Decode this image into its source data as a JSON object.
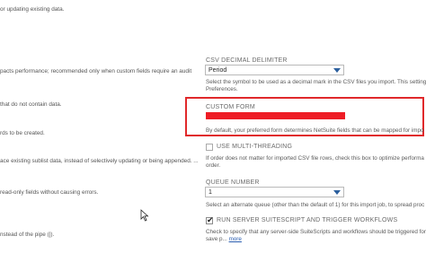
{
  "left_column": {
    "lines": [
      "or updating existing data.",
      "pacts performance; recommended only when custom fields require an audit",
      "that do not contain data.",
      "rds to be created.",
      "ace existing sublist data, instead of selectively updating or being appended. ...",
      "read-only fields without causing errors.",
      "nstead of the pipe (|)."
    ]
  },
  "csv_decimal": {
    "label": "CSV DECIMAL DELIMITER",
    "value": "Period",
    "help_line1": "Select the symbol to be used as a decimal mark in the CSV files you import. This setting o",
    "help_line2": "Preferences."
  },
  "custom_form": {
    "label": "CUSTOM FORM",
    "help": "By default, your preferred form determines NetSuite fields that can be mapped for impo"
  },
  "multithreading": {
    "label": "USE MULTI-THREADING",
    "checked": false,
    "help_line1": "If order does not matter for imported CSV file rows, check this box to optimize performa",
    "help_line2": "order."
  },
  "queue_number": {
    "label": "QUEUE NUMBER",
    "value": "1",
    "help": "Select an alternate queue (other than the default of 1) for this import job, to spread proc"
  },
  "server_suitescript": {
    "label": "RUN SERVER SUITESCRIPT AND TRIGGER WORKFLOWS",
    "checked": true,
    "help_line1": "Check to specify that any server-side SuiteScripts and workflows should be triggered for",
    "help_line2_prefix": "save p...",
    "more_link": "more"
  },
  "colors": {
    "highlight_red": "#e0292b",
    "select_arrow": "#2c5f9e",
    "link": "#2a5db0"
  }
}
